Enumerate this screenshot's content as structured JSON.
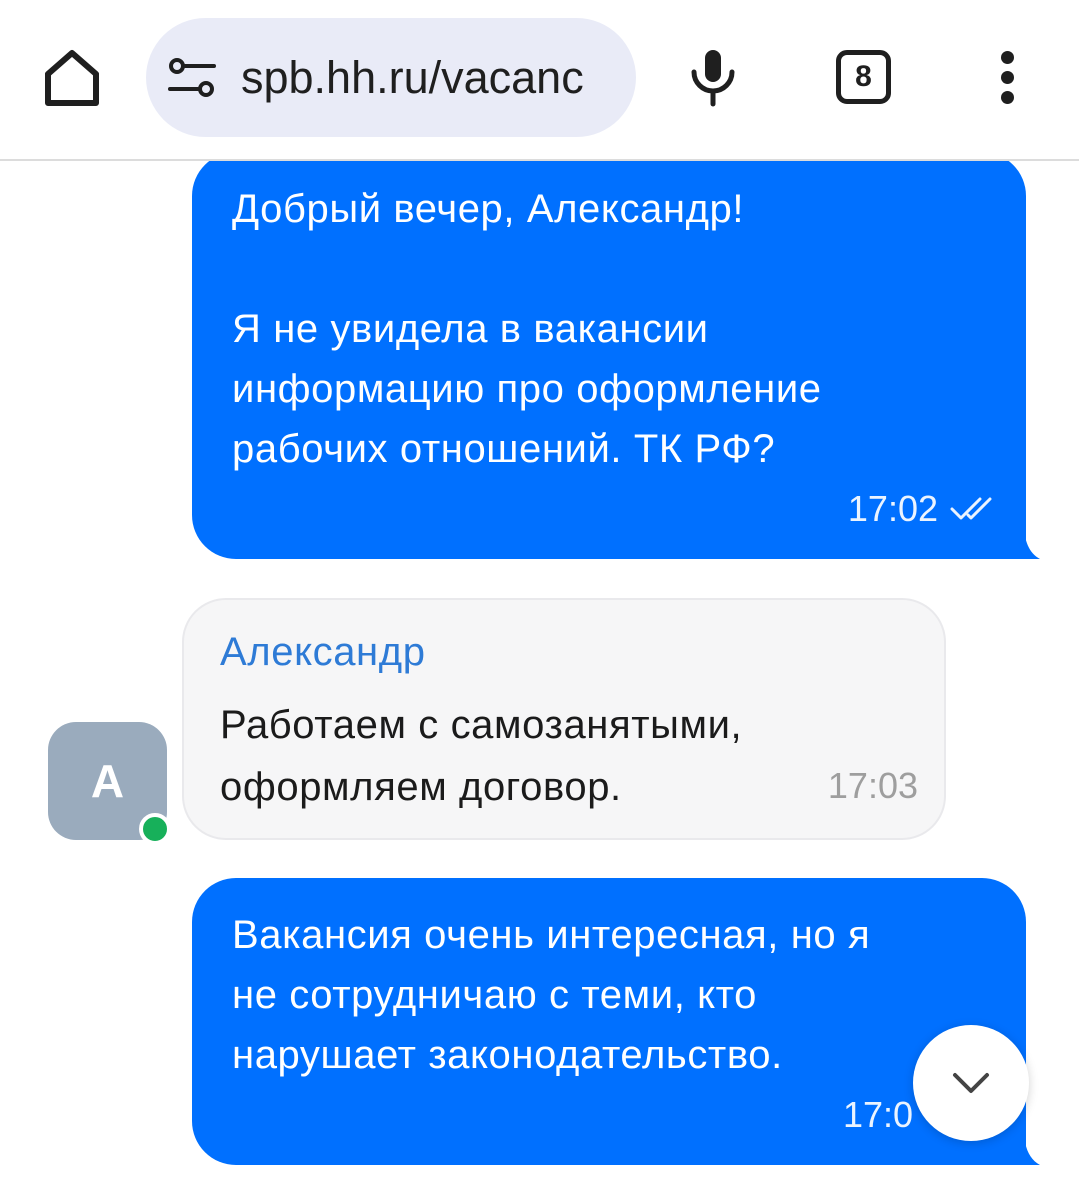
{
  "browser": {
    "url": "spb.hh.ru/vacanc",
    "tab_count": "8",
    "icons": {
      "home": "home-icon",
      "site_info": "tune-icon",
      "voice_search": "mic-icon",
      "menu": "more-vert-icon"
    }
  },
  "chat": {
    "messages": [
      {
        "text": "Добрый вечер, Александр!\n\nЯ не увидела в вакансии\nинформацию про оформление\nрабочих отношений. ТК РФ?",
        "time": "17:02",
        "status_icon": "double-check-icon"
      },
      {
        "sender": "Александр",
        "text": "Работаем с самозанятыми,\nоформляем договор.",
        "time": "17:03"
      },
      {
        "text": "Вакансия очень интересная, но я\nне сотрудничаю с теми, кто\nнарушает законодательство.",
        "time": "17:0"
      }
    ],
    "avatar": {
      "initial": "А",
      "online_indicator": "online-dot-icon"
    },
    "scroll_button_icon": "chevron-down-icon"
  },
  "colors": {
    "outgoing_bubble": "#0070ff",
    "incoming_bubble": "#f6f6f7",
    "sender_name": "#2e7bd6",
    "online": "#17b05a",
    "avatar": "#9aabbd"
  }
}
